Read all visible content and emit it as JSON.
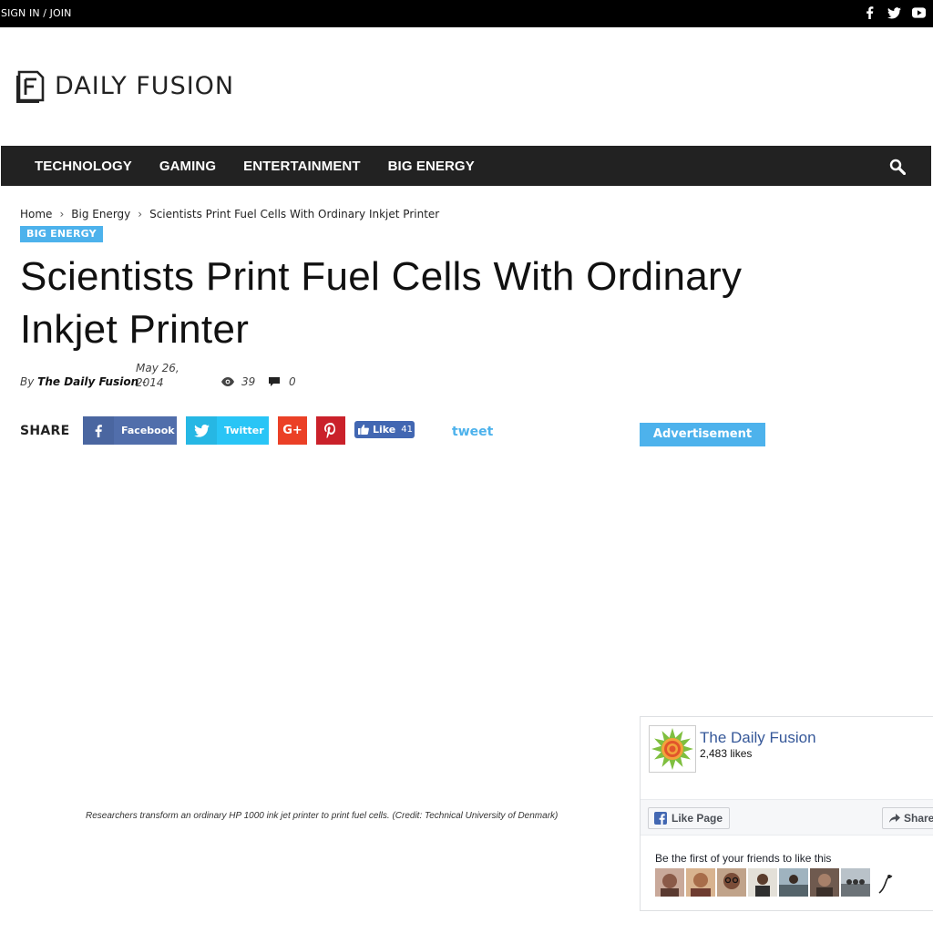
{
  "topbar": {
    "signin_label": "SIGN IN / JOIN",
    "social_icons": [
      "facebook-icon",
      "twitter-icon",
      "youtube-icon"
    ]
  },
  "logo": {
    "text": "DAILY FUSION"
  },
  "nav": {
    "items": [
      {
        "label": "TECHNOLOGY"
      },
      {
        "label": "GAMING"
      },
      {
        "label": "ENTERTAINMENT"
      },
      {
        "label": "BIG ENERGY"
      }
    ],
    "search_icon": "search-icon"
  },
  "breadcrumb": {
    "home": "Home",
    "category": "Big Energy",
    "current": "Scientists Print Fuel Cells With Ordinary Inkjet Printer",
    "separator": "›"
  },
  "article": {
    "category_badge": "BIG ENERGY",
    "title": "Scientists Print Fuel Cells With Ordinary Inkjet Printer",
    "by_label": "By",
    "author": "The Daily Fusion",
    "dash": "-",
    "date": "May 26, 2014",
    "views": "39",
    "comments": "0",
    "caption": "Researchers transform an ordinary HP 1000 ink jet printer to print fuel cells. (Credit: Technical University of Denmark)"
  },
  "share": {
    "label": "SHARE",
    "facebook": "Facebook",
    "twitter": "Twitter",
    "googleplus": "G+",
    "like_label": "Like",
    "like_count": "41",
    "tweet_link": "tweet"
  },
  "sidebar": {
    "ad_label": "Advertisement",
    "fb_page_name": "The Daily Fusion",
    "fb_likes": "2,483 likes",
    "fb_like_page": "Like Page",
    "fb_share": "Share",
    "fb_friends_text": "Be the first of your friends to like this"
  },
  "colors": {
    "accent": "#4db2ec",
    "nav_bg": "#222222",
    "facebook": "#516eab",
    "twitter": "#29c5f6",
    "googleplus": "#eb4026",
    "pinterest": "#ca212a",
    "fb_link": "#365899"
  }
}
